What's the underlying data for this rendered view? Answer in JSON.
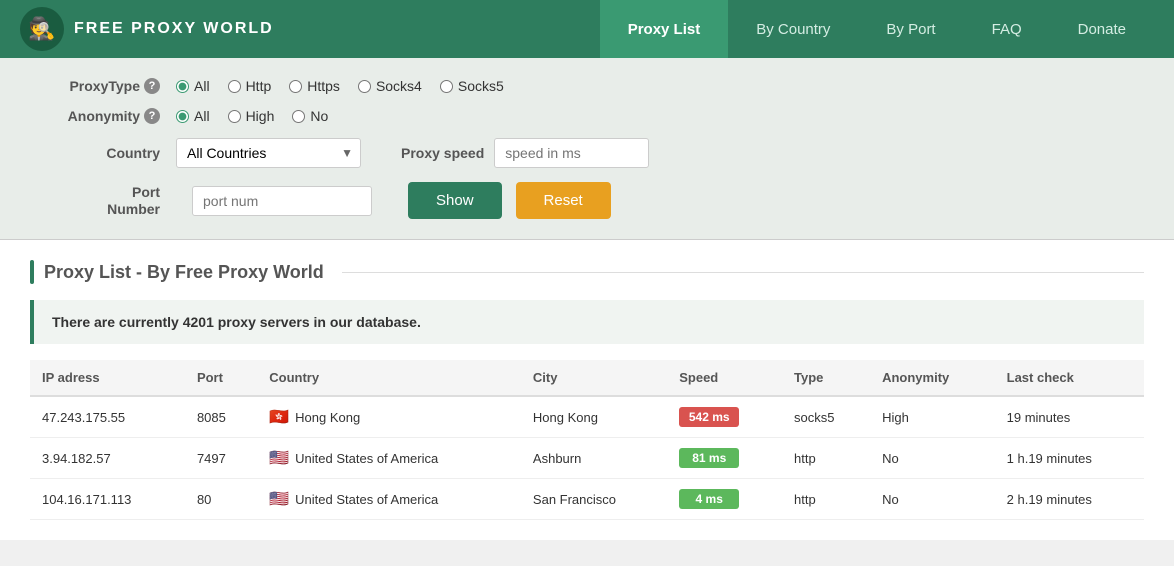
{
  "nav": {
    "logo_icon": "🎩",
    "logo_text": "FREE PROXY WORLD",
    "links": [
      {
        "label": "Proxy List",
        "active": true,
        "id": "proxy-list"
      },
      {
        "label": "By Country",
        "active": false,
        "id": "by-country"
      },
      {
        "label": "By Port",
        "active": false,
        "id": "by-port"
      },
      {
        "label": "FAQ",
        "active": false,
        "id": "faq"
      },
      {
        "label": "Donate",
        "active": false,
        "id": "donate"
      }
    ]
  },
  "filters": {
    "proxy_type_label": "ProxyType",
    "anonymity_label": "Anonymity",
    "country_label": "Country",
    "port_label_line1": "Port",
    "port_label_line2": "Number",
    "proxy_speed_label": "Proxy speed",
    "proxy_type_options": [
      "All",
      "Http",
      "Https",
      "Socks4",
      "Socks5"
    ],
    "proxy_type_selected": "All",
    "anonymity_options": [
      "All",
      "High",
      "No"
    ],
    "anonymity_selected": "All",
    "country_options": [
      "All Countries"
    ],
    "country_selected": "All Countries",
    "port_placeholder": "port num",
    "speed_placeholder": "speed in ms",
    "show_button": "Show",
    "reset_button": "Reset"
  },
  "section": {
    "title": "Proxy List - By Free Proxy World"
  },
  "info": {
    "message": "There are currently 4201 proxy servers in our database."
  },
  "table": {
    "headers": [
      "IP adress",
      "Port",
      "Country",
      "City",
      "Speed",
      "Type",
      "Anonymity",
      "Last check"
    ],
    "rows": [
      {
        "ip": "47.243.175.55",
        "port": "8085",
        "flag": "🇭🇰",
        "country": "Hong Kong",
        "city": "Hong Kong",
        "speed_value": "542",
        "speed_unit": "ms",
        "speed_color": "red",
        "type": "socks5",
        "anonymity": "High",
        "last_check": "19 minutes"
      },
      {
        "ip": "3.94.182.57",
        "port": "7497",
        "flag": "🇺🇸",
        "country": "United States of America",
        "city": "Ashburn",
        "speed_value": "81",
        "speed_unit": "ms",
        "speed_color": "green",
        "type": "http",
        "anonymity": "No",
        "last_check": "1 h.19 minutes"
      },
      {
        "ip": "104.16.171.113",
        "port": "80",
        "flag": "🇺🇸",
        "country": "United States of America",
        "city": "San Francisco",
        "speed_value": "4",
        "speed_unit": "ms",
        "speed_color": "green",
        "type": "http",
        "anonymity": "No",
        "last_check": "2 h.19 minutes"
      }
    ]
  }
}
